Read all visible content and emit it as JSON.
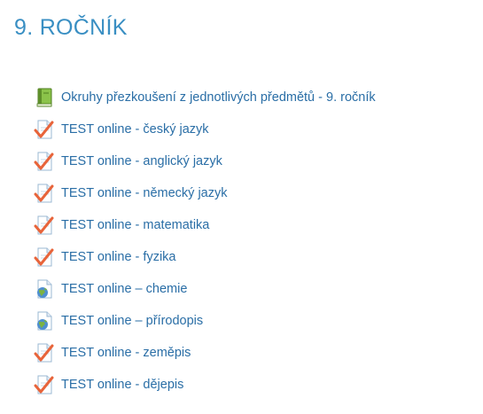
{
  "section": {
    "title": "9. ROČNÍK"
  },
  "activities": [
    {
      "icon": "book-icon",
      "label": "Okruhy přezkoušení z jednotlivých předmětů - 9. ročník"
    },
    {
      "icon": "quiz-icon",
      "label": "TEST online - český jazyk"
    },
    {
      "icon": "quiz-icon",
      "label": "TEST online - anglický jazyk"
    },
    {
      "icon": "quiz-icon",
      "label": "TEST online - německý jazyk"
    },
    {
      "icon": "quiz-icon",
      "label": "TEST online - matematika"
    },
    {
      "icon": "quiz-icon",
      "label": "TEST online - fyzika"
    },
    {
      "icon": "url-icon",
      "label": "TEST online – chemie"
    },
    {
      "icon": "url-icon",
      "label": "TEST online – přírodopis"
    },
    {
      "icon": "quiz-icon",
      "label": "TEST online - zeměpis"
    },
    {
      "icon": "quiz-icon",
      "label": "TEST online - dějepis"
    }
  ],
  "colors": {
    "title": "#3a8fc3",
    "link": "#2a6ea6",
    "book": "#7cb342",
    "checkmark": "#e8643a"
  }
}
